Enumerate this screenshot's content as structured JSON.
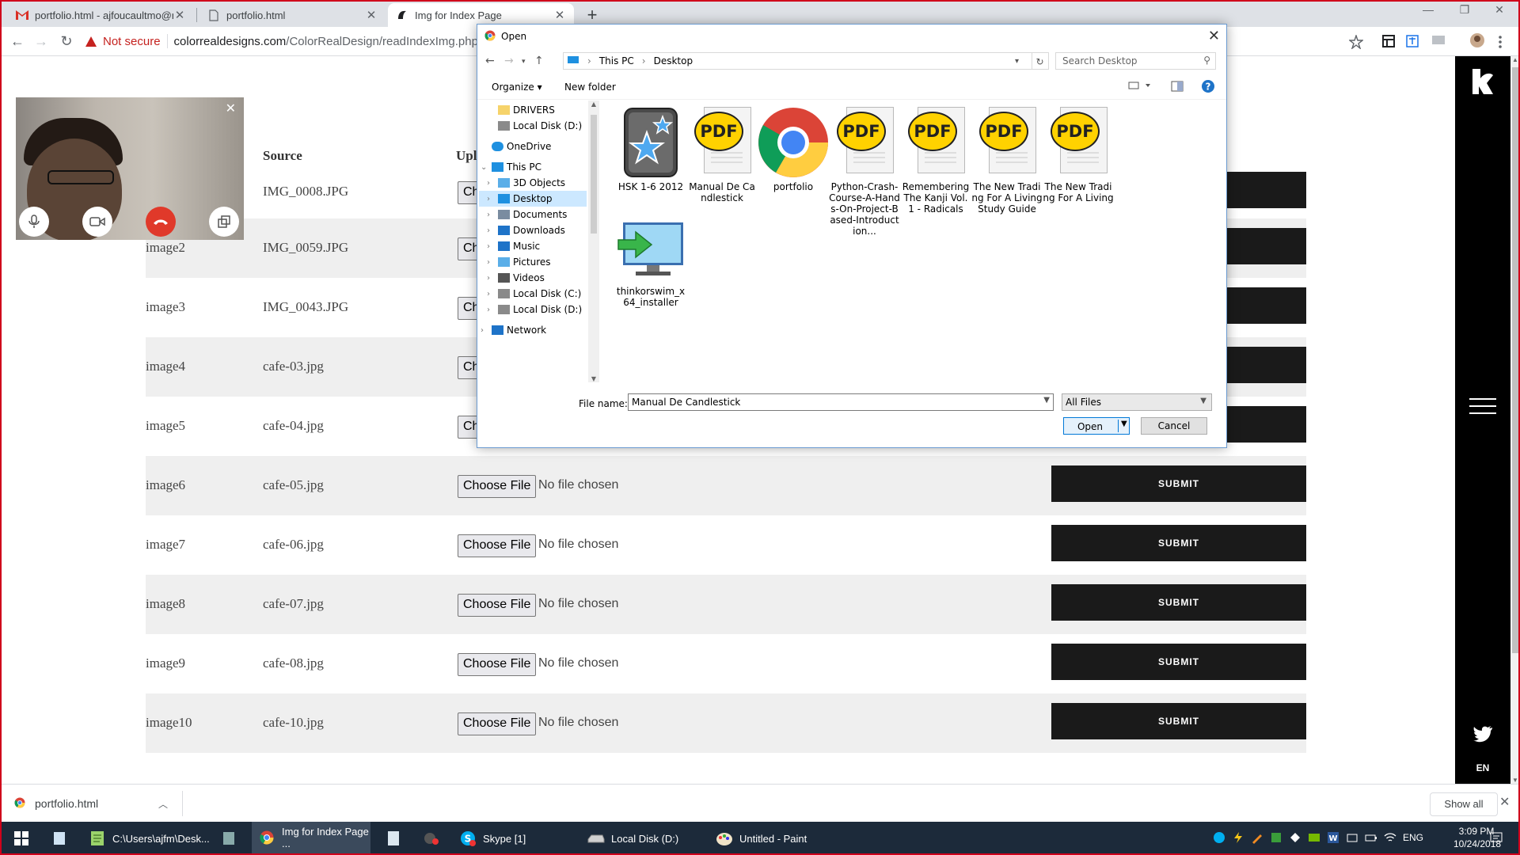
{
  "browser": {
    "tabs": [
      {
        "title": "portfolio.html - ajfoucaultmo@m",
        "icon": "gmail-icon",
        "active": false
      },
      {
        "title": "portfolio.html",
        "icon": "document-icon",
        "active": false
      },
      {
        "title": "Img for Index Page",
        "icon": "site-icon",
        "active": true
      }
    ],
    "security_label": "Not secure",
    "url_host": "colorrealdesigns.com",
    "url_path": "/ColorRealDesign/readIndexImg.php"
  },
  "page": {
    "headers": {
      "source": "Source",
      "upload": "Upl"
    },
    "choose_label": "Choose File",
    "no_file_label": "No file chosen",
    "submit_label": "SUBMIT",
    "rows": [
      {
        "name": "",
        "source": "IMG_0008.JPG",
        "choose": "Ch"
      },
      {
        "name": "image2",
        "source": "IMG_0059.JPG",
        "choose": "Ch"
      },
      {
        "name": "image3",
        "source": "IMG_0043.JPG",
        "choose": "Ch"
      },
      {
        "name": "image4",
        "source": "cafe-03.jpg",
        "choose": "Ch"
      },
      {
        "name": "image5",
        "source": "cafe-04.jpg",
        "choose": "Ch"
      },
      {
        "name": "image6",
        "source": "cafe-05.jpg"
      },
      {
        "name": "image7",
        "source": "cafe-06.jpg"
      },
      {
        "name": "image8",
        "source": "cafe-07.jpg"
      },
      {
        "name": "image9",
        "source": "cafe-08.jpg"
      },
      {
        "name": "image10",
        "source": "cafe-10.jpg"
      }
    ],
    "language": "EN"
  },
  "dialog": {
    "title": "Open",
    "breadcrumb": [
      "This PC",
      "Desktop"
    ],
    "search_placeholder": "Search Desktop",
    "organize": "Organize",
    "new_folder": "New folder",
    "nav_items": [
      {
        "label": "DRIVERS",
        "icon": "folder-icon"
      },
      {
        "label": "Local Disk (D:)",
        "icon": "drive-icon"
      },
      {
        "label": "OneDrive",
        "icon": "cloud-icon"
      },
      {
        "label": "This PC",
        "icon": "pc-icon"
      },
      {
        "label": "3D Objects",
        "icon": "cube-icon"
      },
      {
        "label": "Desktop",
        "icon": "desktop-icon",
        "selected": true
      },
      {
        "label": "Documents",
        "icon": "documents-icon"
      },
      {
        "label": "Downloads",
        "icon": "download-icon"
      },
      {
        "label": "Music",
        "icon": "music-icon"
      },
      {
        "label": "Pictures",
        "icon": "pictures-icon"
      },
      {
        "label": "Videos",
        "icon": "videos-icon"
      },
      {
        "label": "Local Disk (C:)",
        "icon": "drive-icon"
      },
      {
        "label": "Local Disk (D:)",
        "icon": "drive-icon"
      },
      {
        "label": "Network",
        "icon": "network-icon"
      }
    ],
    "files": [
      {
        "label": "HSK 1-6 2012",
        "icon": "star-app-icon"
      },
      {
        "label": "Manual De Candlestick",
        "icon": "pdf-icon"
      },
      {
        "label": "portfolio",
        "icon": "chrome-icon"
      },
      {
        "label": "Python-Crash-Course-A-Hands-On-Project-Based-Introduction...",
        "icon": "pdf-icon"
      },
      {
        "label": "Remembering The Kanji Vol. 1 - Radicals",
        "icon": "pdf-icon"
      },
      {
        "label": "The New Trading For A Living Study Guide",
        "icon": "pdf-icon"
      },
      {
        "label": "The New Trading For A Living",
        "icon": "pdf-icon"
      },
      {
        "label": "thinkorswim_x64_installer",
        "icon": "installer-icon"
      }
    ],
    "file_name_label": "File name:",
    "file_name_value": "Manual De Candlestick",
    "file_type": "All Files",
    "open_label": "Open",
    "cancel_label": "Cancel",
    "pdf_badge": "PDF"
  },
  "downloads": {
    "item": "portfolio.html",
    "show_all": "Show all"
  },
  "taskbar": {
    "items": [
      {
        "label": "C:\\Users\\ajfm\\Desk...",
        "icon": "notepad-icon"
      },
      {
        "label": "Img for Index Page ...",
        "icon": "chrome-icon",
        "active": true
      },
      {
        "label": "Skype [1]",
        "icon": "skype-icon"
      },
      {
        "label": "Local Disk (D:)",
        "icon": "drive-icon"
      },
      {
        "label": "Untitled - Paint",
        "icon": "paint-icon"
      }
    ],
    "lang": "ENG",
    "time": "3:09 PM",
    "date": "10/24/2018"
  },
  "colors": {
    "accent": "#0078d7",
    "warning": "#c5221f",
    "submit_bg": "#1a1a1a"
  }
}
